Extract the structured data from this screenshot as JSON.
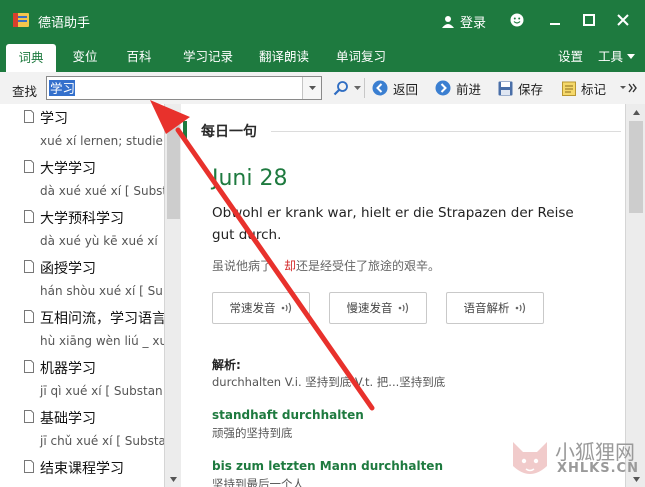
{
  "window": {
    "title": "德语助手",
    "login": "登录"
  },
  "menu": {
    "tabs": [
      "词典",
      "变位",
      "百科",
      "学习记录",
      "翻译朗读",
      "单词复习"
    ],
    "settings": "设置",
    "tools": "工具"
  },
  "toolbar": {
    "search_label": "查找",
    "search_value": "学习",
    "back": "返回",
    "forward": "前进",
    "save": "保存",
    "bookmark": "标记"
  },
  "entries": [
    {
      "head": "学习",
      "pron": "xué xí lernen; studier"
    },
    {
      "head": "大学学习",
      "pron": "dà xué xué xí [ Subst"
    },
    {
      "head": "大学预科学习",
      "pron": "dà xué yù kē xué xí"
    },
    {
      "head": "函授学习",
      "pron": "hán shòu xué xí [ Su"
    },
    {
      "head": "互相问流，学习语言",
      "pron": "hù xiāng wèn liú _ xu"
    },
    {
      "head": "机器学习",
      "pron": "jī qì xué xí [ Substan"
    },
    {
      "head": "基础学习",
      "pron": "jī chǔ xué xí [ Substa"
    },
    {
      "head": "结束课程学习",
      "pron": ""
    }
  ],
  "daily": {
    "section_title": "每日一句",
    "date": "Juni 28",
    "sentence": "Obwohl er krank war, hielt er die Strapazen der Reise gut durch.",
    "translation_prefix": "虽说他病了",
    "translation_highlight": "，却",
    "translation_suffix": "还是经受住了旅途的艰辛。",
    "audio_buttons": [
      "常速发音",
      "慢速发音",
      "语音解析"
    ],
    "analysis_title": "解析:",
    "analysis_line": "durchhalten V.i. 坚持到底 V.t. 把...坚持到底",
    "phrases": [
      {
        "de": "standhaft durchhalten",
        "zh": "顽强的坚持到底"
      },
      {
        "de": "bis zum letzten Mann durchhalten",
        "zh": "坚持到最后一个人"
      }
    ]
  },
  "watermark": {
    "name": "小狐狸网",
    "domain": "XHLKS.CN"
  },
  "colors": {
    "brand": "#1e7a3f",
    "arrow": "#e8312c",
    "selection": "#3470cc"
  }
}
